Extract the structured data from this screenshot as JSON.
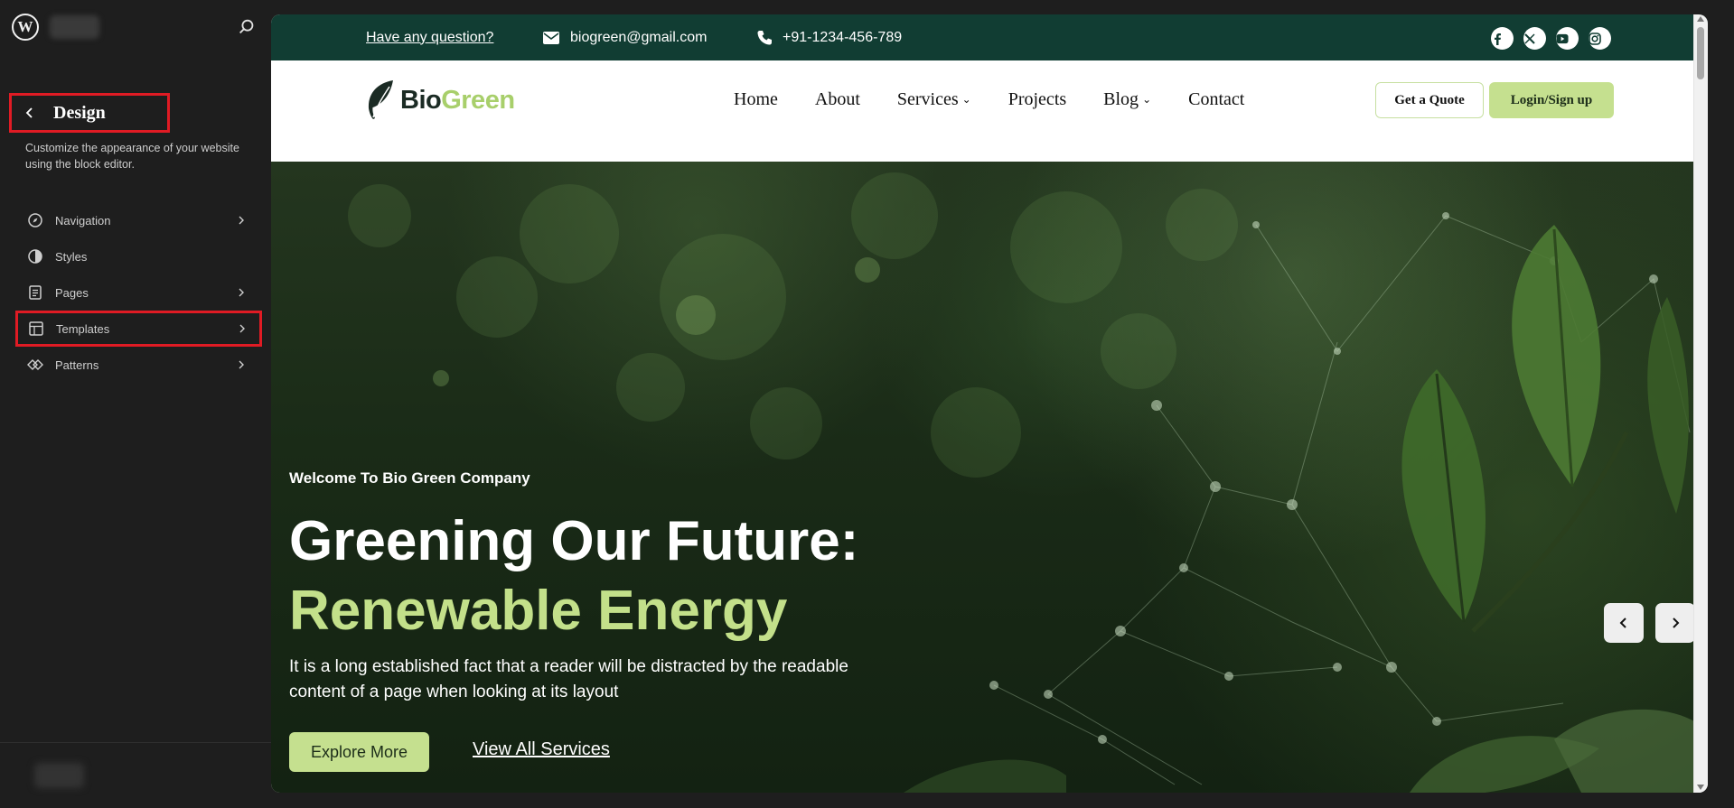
{
  "sidebar": {
    "panel_title": "Design",
    "description": "Customize the appearance of your website using the block editor.",
    "items": [
      {
        "label": "Navigation",
        "icon": "navigation-icon"
      },
      {
        "label": "Styles",
        "icon": "styles-icon"
      },
      {
        "label": "Pages",
        "icon": "pages-icon"
      },
      {
        "label": "Templates",
        "icon": "templates-icon"
      },
      {
        "label": "Patterns",
        "icon": "patterns-icon"
      }
    ],
    "wp_logo": "W"
  },
  "site": {
    "topbar": {
      "question": "Have any question?",
      "email": "biogreen@gmail.com",
      "phone": "+91-1234-456-789",
      "socials": [
        "facebook-icon",
        "x-icon",
        "youtube-icon",
        "instagram-icon"
      ]
    },
    "logo": {
      "part1": "Bio",
      "part2": "Green"
    },
    "menu": [
      "Home",
      "About",
      "Services",
      "Projects",
      "Blog",
      "Contact"
    ],
    "quote_button": "Get a Quote",
    "login_button": "Login/Sign up",
    "hero": {
      "welcome": "Welcome To Bio Green Company",
      "headline_line1": "Greening Our Future:",
      "headline_line2": "Renewable Energy",
      "description": "It is a long established fact that a reader will be distracted by the readable content of a page when looking at its layout",
      "explore_button": "Explore More",
      "services_link": "View All Services"
    }
  },
  "colors": {
    "sidebar_bg": "#1e1e1e",
    "highlight_border": "#e01b24",
    "topbar_bg": "#113d33",
    "accent_green": "#c5e08f",
    "logo_green": "#a8cf6b"
  }
}
